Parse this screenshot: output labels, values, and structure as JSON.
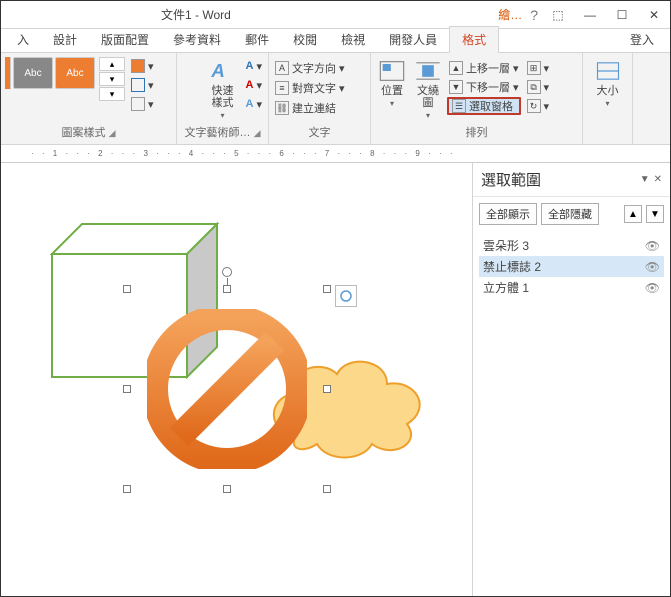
{
  "titlebar": {
    "title": "文件1 - Word",
    "tool_context": "繪…"
  },
  "tabs": {
    "insert": "入",
    "design": "設計",
    "layout": "版面配置",
    "references": "參考資料",
    "mailings": "郵件",
    "review": "校閱",
    "view": "檢視",
    "developer": "開發人員",
    "format": "格式",
    "login": "登入"
  },
  "ribbon": {
    "shape_styles": {
      "abc": "Abc",
      "label": "圖案樣式"
    },
    "wordart": {
      "quick_styles": "快速樣式",
      "label": "文字藝術師…"
    },
    "text": {
      "direction": "文字方向",
      "align": "對齊文字",
      "link": "建立連結",
      "label": "文字"
    },
    "arrange": {
      "position": "位置",
      "wrap": "文繞圖",
      "bring_forward": "上移一層",
      "send_backward": "下移一層",
      "selection_pane": "選取窗格",
      "label": "排列"
    },
    "size": {
      "label": "大小"
    }
  },
  "ruler": "· · 1 · · · 2 · · · 3 · · · 4 · · · 5 · · · 6 · · · 7 · · · 8 · · · 9 · · ·",
  "selpane": {
    "title": "選取範圍",
    "show_all": "全部顯示",
    "hide_all": "全部隱藏",
    "items": [
      {
        "label": "雲朵形 3"
      },
      {
        "label": "禁止標誌 2"
      },
      {
        "label": "立方體 1"
      }
    ]
  }
}
